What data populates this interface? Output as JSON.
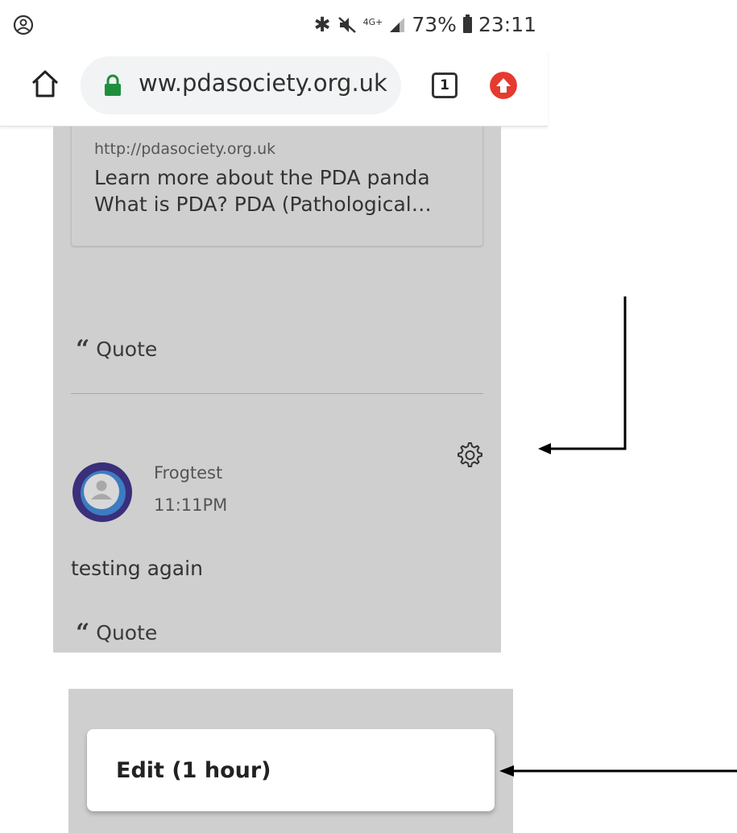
{
  "status_bar": {
    "network": "4G+",
    "battery": "73%",
    "time": "23:11"
  },
  "browser": {
    "url": "ww.pdasociety.org.uk",
    "tab_count": "1"
  },
  "link_preview": {
    "url": "http://pdasociety.org.uk",
    "title_line1": "Learn more about the PDA panda",
    "title_line2": "What is PDA?  PDA (Pathological…"
  },
  "post1": {
    "quote_label": "Quote"
  },
  "post2": {
    "username": "Frogtest",
    "time": "11:11PM",
    "message": "testing again",
    "quote_label": "Quote"
  },
  "menu": {
    "edit_label": "Edit (1 hour)"
  },
  "colors": {
    "content_bg": "#cfcfcf",
    "update_badge": "#e53b2e",
    "lock_green": "#1e8e3e",
    "avatar_outer": "#3a2f7a",
    "avatar_inner": "#3b7cc2"
  }
}
